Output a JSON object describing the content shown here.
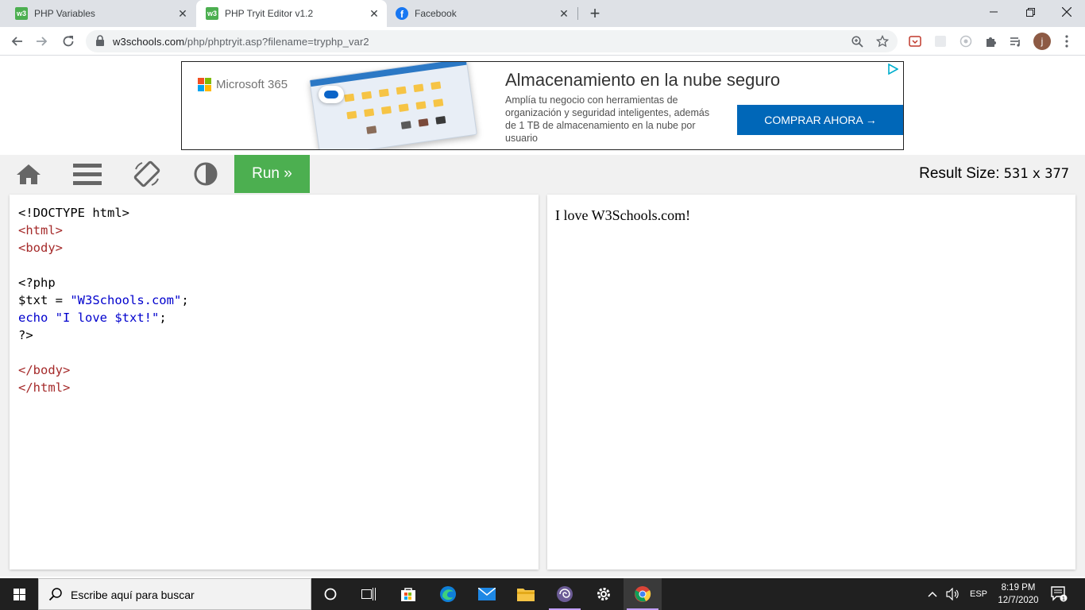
{
  "browser": {
    "tabs": [
      {
        "title": "PHP Variables",
        "favicon": "w3schools-icon",
        "active": false
      },
      {
        "title": "PHP Tryit Editor v1.2",
        "favicon": "w3schools-icon",
        "active": true
      },
      {
        "title": "Facebook",
        "favicon": "facebook-icon",
        "active": false
      }
    ],
    "url_host": "w3schools.com",
    "url_path": "/php/phptryit.asp?filename=tryphp_var2",
    "profile_initial": "j"
  },
  "ad": {
    "brand": "Microsoft 365",
    "headline": "Almacenamiento en la nube seguro",
    "body": "Amplía tu negocio con herramientas de organización y seguridad inteligentes, además de 1 TB de almacenamiento en la nube por usuario",
    "cta": "COMPRAR AHORA →"
  },
  "tryit": {
    "run_label": "Run »",
    "result_size_label": "Result Size:",
    "result_width": "531",
    "result_x": "x",
    "result_height": "377",
    "code_lines": [
      [
        {
          "t": "<!DOCTYPE html>",
          "c": "plain"
        }
      ],
      [
        {
          "t": "<html>",
          "c": "tag"
        }
      ],
      [
        {
          "t": "<body>",
          "c": "tag"
        }
      ],
      [
        {
          "t": "",
          "c": "plain"
        }
      ],
      [
        {
          "t": "<?php",
          "c": "plain"
        }
      ],
      [
        {
          "t": "$txt = ",
          "c": "plain"
        },
        {
          "t": "\"W3Schools.com\"",
          "c": "str"
        },
        {
          "t": ";",
          "c": "plain"
        }
      ],
      [
        {
          "t": "echo ",
          "c": "kw"
        },
        {
          "t": "\"I love $txt!\"",
          "c": "str"
        },
        {
          "t": ";",
          "c": "plain"
        }
      ],
      [
        {
          "t": "?>",
          "c": "plain"
        }
      ],
      [
        {
          "t": "",
          "c": "plain"
        }
      ],
      [
        {
          "t": "</body>",
          "c": "tag"
        }
      ],
      [
        {
          "t": "</html>",
          "c": "tag"
        }
      ]
    ],
    "result_text": "I love W3Schools.com!"
  },
  "taskbar": {
    "search_placeholder": "Escribe aquí para buscar",
    "language": "ESP",
    "time": "8:19 PM",
    "date": "12/7/2020",
    "notification_count": "1"
  }
}
